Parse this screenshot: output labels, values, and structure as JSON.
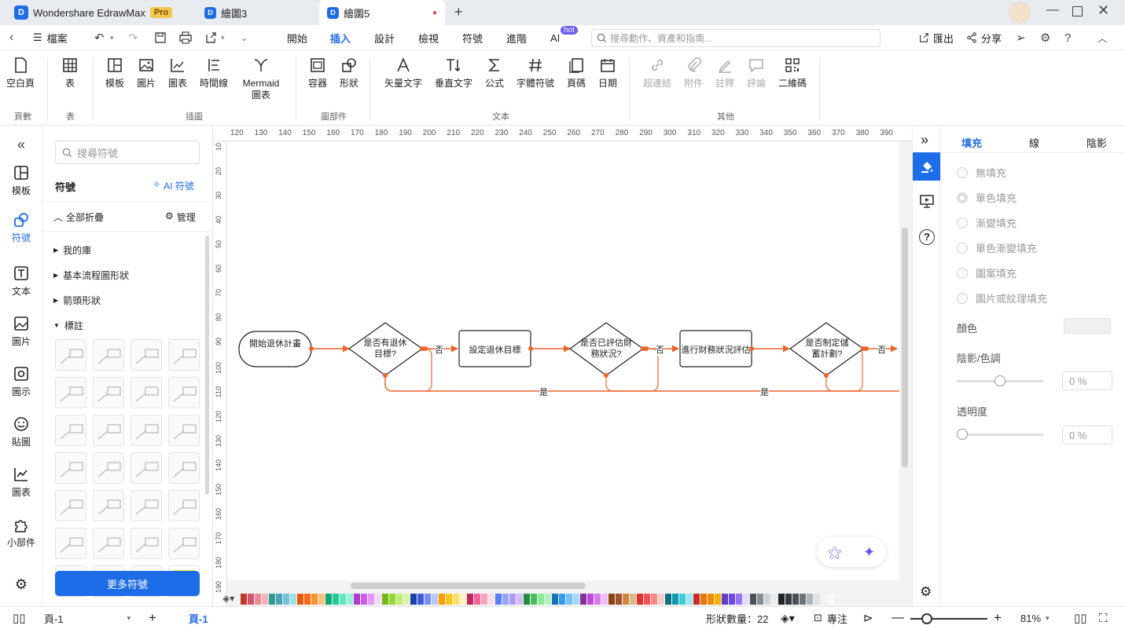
{
  "titlebar": {
    "app_name": "Wondershare EdrawMax",
    "pro_badge": "Pro",
    "tab1": "繪圖3",
    "tab2": "繪圖5"
  },
  "menubar": {
    "file": "檔案",
    "items": [
      "開始",
      "插入",
      "設計",
      "檢視",
      "符號",
      "進階",
      "AI"
    ],
    "ai_badge": "hot",
    "search_placeholder": "搜尋動作、資產和指南...",
    "export": "匯出",
    "share": "分享"
  },
  "ribbon": {
    "buttons": {
      "blank_page": "空白頁",
      "table": "表",
      "template": "模板",
      "image": "圖片",
      "chart": "圖表",
      "timeline": "時間線",
      "mermaid_1": "Mermaid",
      "mermaid_2": "圖表",
      "container": "容器",
      "shape": "形狀",
      "vector_text": "矢量文字",
      "vertical_text": "垂直文字",
      "formula": "公式",
      "font_symbol": "字體符號",
      "page_num": "頁碼",
      "date": "日期",
      "hyperlink": "超連結",
      "attachment": "附件",
      "note": "註釋",
      "comment": "評論",
      "qrcode": "二維碼"
    },
    "groups": {
      "pages": "頁數",
      "table": "表",
      "illustration": "插圖",
      "parts": "圖部件",
      "text": "文本",
      "other": "其他"
    }
  },
  "leftbar": {
    "items": [
      "模板",
      "符號",
      "文本",
      "圖片",
      "圖示",
      "貼圖",
      "圖表",
      "小部件"
    ]
  },
  "symbols": {
    "search_placeholder": "搜尋符號",
    "title": "符號",
    "ai_symbol": "AI 符號",
    "collapse_all": "全部折疊",
    "manage": "管理",
    "categories": [
      "我的庫",
      "基本流程圖形狀",
      "箭頭形狀",
      "標註"
    ],
    "more": "更多符號"
  },
  "ruler": {
    "h": [
      "120",
      "130",
      "140",
      "150",
      "160",
      "170",
      "180",
      "190",
      "200",
      "210",
      "220",
      "230",
      "240",
      "250",
      "260",
      "270",
      "280",
      "290",
      "300",
      "310",
      "320",
      "330",
      "340",
      "350",
      "360",
      "370",
      "380",
      "390"
    ],
    "v": [
      "10",
      "20",
      "30",
      "40",
      "50",
      "60",
      "70",
      "80",
      "90",
      "100",
      "110",
      "120",
      "130",
      "140",
      "150",
      "160",
      "170",
      "180",
      "190"
    ]
  },
  "diagram": {
    "start": "開始退休計畫",
    "q1": "是否有退休目標?",
    "p1": "設定退休目標",
    "q2": "是否已評估財務狀況?",
    "p2": "進行財務狀況評估",
    "q3": "是否制定儲蓄計劃?",
    "no": "否",
    "yes": "是"
  },
  "rightpanel": {
    "tabs": [
      "填充",
      "線",
      "陰影"
    ],
    "fill_options": [
      "無填充",
      "單色填充",
      "漸變填充",
      "單色漸變填充",
      "圖案填充",
      "圖片或紋理填充"
    ],
    "color_label": "顏色",
    "shade_label": "陰影/色調",
    "shade_value": "0 %",
    "transparency_label": "透明度",
    "transparency_value": "0 %"
  },
  "statusbar": {
    "page_select": "頁-1",
    "page_tab": "頁-1",
    "shape_count": "形狀數量：22",
    "focus": "專注",
    "zoom": "81%"
  },
  "colors": {
    "accent": "#1e6de8",
    "flow_line": "#f0642a"
  }
}
